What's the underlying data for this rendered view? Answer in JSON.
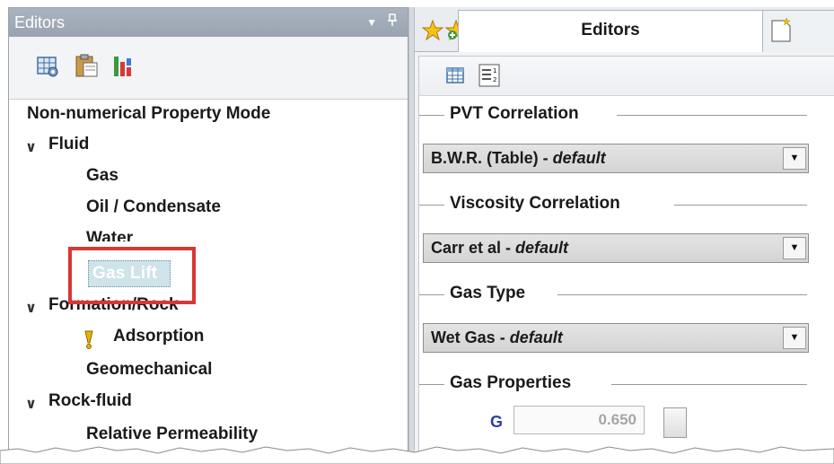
{
  "left_panel": {
    "title": "Editors",
    "toolbar_icons": [
      "grid-settings-icon",
      "paste-clipboard-icon",
      "bar-chart-icon"
    ],
    "tree": [
      {
        "label": "Non-numerical Property Mode",
        "type": "header"
      },
      {
        "label": "Fluid",
        "type": "group",
        "expanded": true,
        "children": [
          "Gas",
          "Oil / Condensate",
          "Water",
          "Gas Lift"
        ]
      },
      {
        "label": "Formation/Rock",
        "type": "group",
        "expanded": true,
        "children": [
          "Adsorption",
          "Geomechanical"
        ]
      },
      {
        "label": "Rock-fluid",
        "type": "group",
        "expanded": true,
        "children": [
          "Relative Permeability"
        ]
      }
    ],
    "selected_item": "Gas Lift",
    "warning_item": "Adsorption"
  },
  "right_panel": {
    "tabs": [
      {
        "name": "favorites-star-icon"
      },
      {
        "name": "add-favorite-star-icon"
      },
      {
        "label": "Editors",
        "active": true
      },
      {
        "name": "new-document-icon"
      }
    ],
    "toolbar_icons": [
      "table-view-icon",
      "list-view-icon"
    ],
    "sections": [
      {
        "title": "PVT Correlation",
        "value": "B.W.R. (Table)",
        "suffix": "default"
      },
      {
        "title": "Viscosity Correlation",
        "value": "Carr et al",
        "suffix": "default"
      },
      {
        "title": "Gas Type",
        "value": "Wet Gas",
        "suffix": "default"
      },
      {
        "title": "Gas Properties"
      }
    ],
    "gas_property": {
      "label": "G",
      "value": "0.650"
    }
  },
  "colors": {
    "title_bar": "#9aa4b1",
    "selection_fill": "#cfe3ea",
    "highlight_box": "#d93636",
    "link_blue": "#2b3fa8",
    "warning_yellow": "#e8b400"
  }
}
